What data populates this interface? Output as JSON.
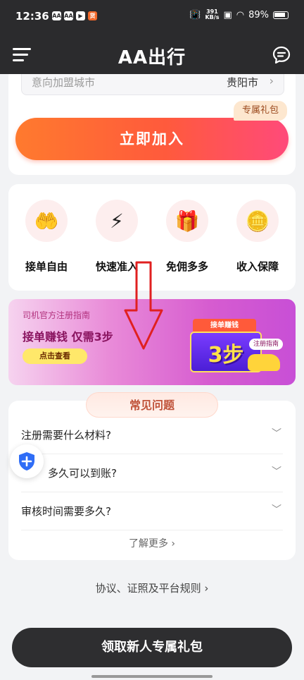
{
  "status_bar": {
    "time": "12:36",
    "net_speed_value": "391",
    "net_speed_unit": "KB/s",
    "battery": "89%",
    "apps": [
      "AA",
      "AA",
      "▶",
      "货"
    ]
  },
  "header": {
    "logo_text": "AA出行",
    "menu_icon": "menu-icon",
    "message_icon": "message-icon"
  },
  "join_card": {
    "city_label": "意向加盟城市",
    "city_value": "贵阳市",
    "gift_tag": "专属礼包",
    "join_button": "立即加入"
  },
  "features": [
    {
      "label": "接单自由",
      "icon": "hand-coin-icon"
    },
    {
      "label": "快速准入",
      "icon": "lightning-icon"
    },
    {
      "label": "免佣多多",
      "icon": "gift-icon"
    },
    {
      "label": "收入保障",
      "icon": "coins-icon"
    }
  ],
  "banner": {
    "title": "司机官方注册指南",
    "headline": "接单赚钱 仅需3步",
    "button": "点击查看",
    "ribbon": "接单赚钱",
    "big_text": "3步",
    "tag": "注册指南"
  },
  "faq": {
    "heading": "常见问题",
    "items": [
      {
        "question": "注册需要什么材料?"
      },
      {
        "question": "多久可以到账?"
      },
      {
        "question": "审核时间需要多久?"
      }
    ],
    "more": "了解更多 ›"
  },
  "rules_link": "协议、证照及平台规则 ›",
  "bottom_button": "领取新人专属礼包",
  "colors": {
    "header_bg": "#2b2b2d",
    "join_gradient_start": "#ff7a2e",
    "join_gradient_end": "#ff4a7a",
    "annotation_arrow": "#e02020"
  }
}
